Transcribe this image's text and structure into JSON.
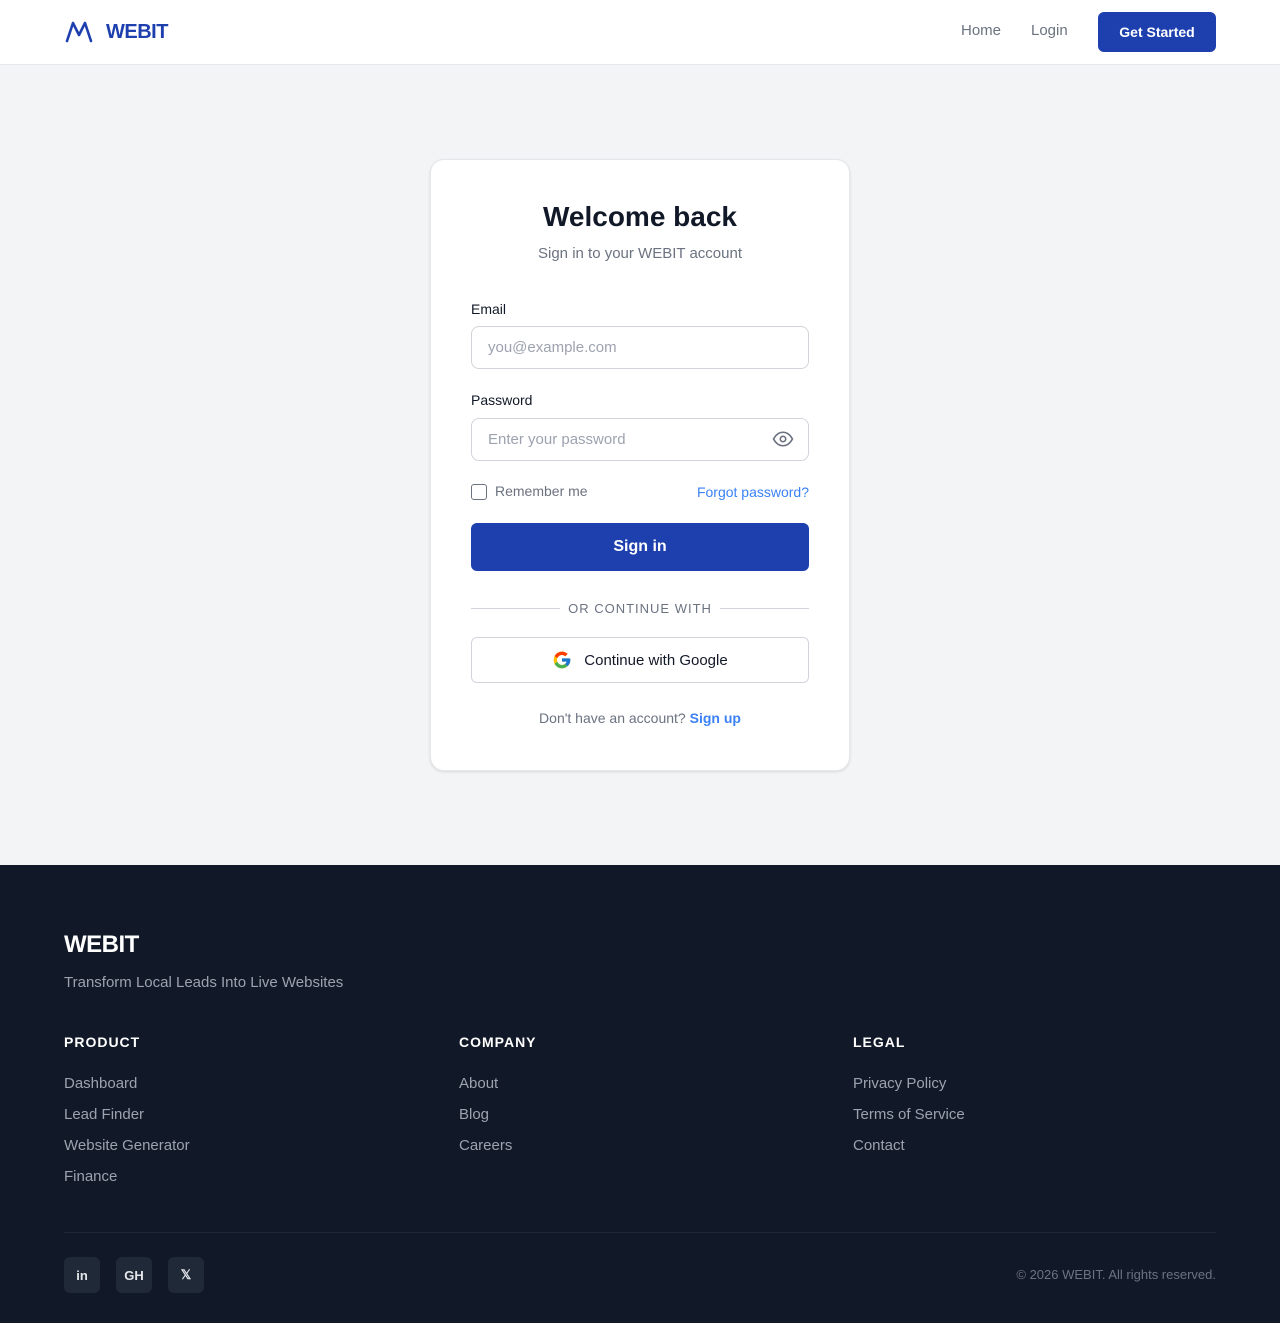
{
  "header": {
    "brand": "WEBIT",
    "nav": {
      "home": "Home",
      "login": "Login"
    },
    "cta": "Get Started"
  },
  "login": {
    "title": "Welcome back",
    "subtitle": "Sign in to your WEBIT account",
    "email_label": "Email",
    "email_placeholder": "you@example.com",
    "password_label": "Password",
    "password_placeholder": "Enter your password",
    "remember": "Remember me",
    "forgot": "Forgot password?",
    "submit": "Sign in",
    "divider": "OR CONTINUE WITH",
    "google": "Continue with Google",
    "no_account": "Don't have an account?",
    "signup": "Sign up"
  },
  "footer": {
    "brand": "WEBIT",
    "tagline": "Transform Local Leads Into Live Websites",
    "columns": [
      {
        "title": "PRODUCT",
        "links": [
          "Dashboard",
          "Lead Finder",
          "Website Generator",
          "Finance"
        ]
      },
      {
        "title": "COMPANY",
        "links": [
          "About",
          "Blog",
          "Careers"
        ]
      },
      {
        "title": "LEGAL",
        "links": [
          "Privacy Policy",
          "Terms of Service",
          "Contact"
        ]
      }
    ],
    "social": [
      "in",
      "GH",
      "𝕏"
    ],
    "copyright": "© 2026 WEBIT. All rights reserved."
  },
  "colors": {
    "primary": "#1e40af",
    "link": "#3b82f6",
    "footer_bg": "#111827",
    "page_bg": "#f3f4f6"
  },
  "icons": [
    "webit-logo-icon",
    "eye-icon",
    "google-icon",
    "linkedin-icon",
    "github-icon",
    "x-icon"
  ]
}
